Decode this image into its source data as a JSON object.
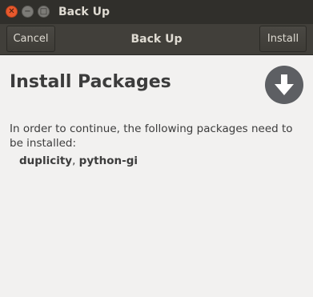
{
  "window": {
    "title": "Back Up"
  },
  "headerbar": {
    "cancel_label": "Cancel",
    "title": "Back Up",
    "install_label": "Install"
  },
  "main": {
    "heading": "Install Packages",
    "description": "In order to continue, the following packages need to be installed:",
    "packages": [
      "duplicity",
      "python-gi"
    ],
    "separator": ", ",
    "icon": "download-icon"
  },
  "colors": {
    "titlebar": "#302f2b",
    "headerbar": "#413f3a",
    "close_button": "#e8592d",
    "icon_circle": "#5d5f63",
    "background": "#f2f1f0"
  }
}
